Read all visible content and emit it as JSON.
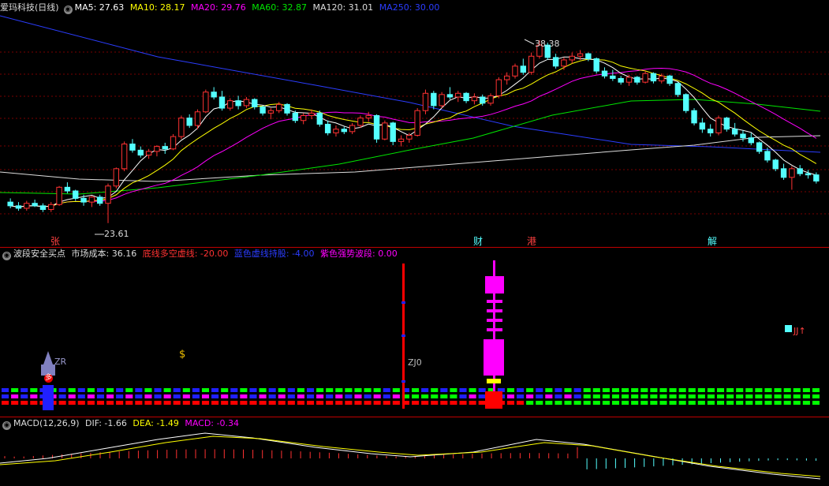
{
  "colors": {
    "up": "#ff3232",
    "down": "#54ffff",
    "ma5": "#ffffff",
    "ma10": "#ffff00",
    "ma20": "#ff00ff",
    "ma60": "#00e600",
    "ma120": "#dddddd",
    "ma250": "#2b3dff"
  },
  "main": {
    "stock_name": "爱玛科技(日线)",
    "ma5": "MA5: 27.63",
    "ma10": "MA10: 28.17",
    "ma20": "MA20: 29.76",
    "ma60": "MA60: 32.87",
    "ma120": "MA120: 31.01",
    "ma250": "MA250: 30.00",
    "high_label": "38.38",
    "low_label": "23.61",
    "markers": [
      "张",
      "财",
      "港",
      "解"
    ]
  },
  "indicator": {
    "name": "波段安全买点",
    "cost": "市场成本: 36.16",
    "bottom": "底线多空虚线: -20.00",
    "blue": "蓝色虚线持股: -4.00",
    "purple": "紫色强势波段: 0.00",
    "zr": "ZR",
    "zj": "ZJ0",
    "jj": "JJ↑",
    "duo": "多"
  },
  "macd": {
    "name": "MACD(12,26,9)",
    "dif": "DIF: -1.66",
    "dea": "DEA: -1.49",
    "macd": "MACD: -0.34"
  },
  "chart_data": {
    "type": "candlestick",
    "price_high": 38.38,
    "price_low": 23.61,
    "ylim": [
      22.5,
      40.5
    ],
    "candles": [
      [
        25.3,
        25.6,
        24.8,
        25.0
      ],
      [
        25.0,
        25.3,
        24.6,
        24.8
      ],
      [
        24.8,
        25.4,
        24.6,
        25.2
      ],
      [
        25.2,
        25.5,
        24.9,
        25.0
      ],
      [
        25.0,
        25.2,
        24.5,
        24.7
      ],
      [
        24.7,
        25.3,
        24.5,
        25.1
      ],
      [
        25.1,
        26.6,
        25.0,
        26.5
      ],
      [
        26.5,
        26.9,
        26.0,
        26.2
      ],
      [
        26.2,
        26.3,
        25.4,
        25.6
      ],
      [
        25.6,
        25.9,
        25.0,
        25.3
      ],
      [
        25.3,
        25.8,
        24.9,
        25.7
      ],
      [
        25.7,
        25.9,
        25.0,
        25.2
      ],
      [
        25.2,
        26.8,
        23.6,
        26.6
      ],
      [
        26.6,
        28.1,
        26.4,
        28.0
      ],
      [
        28.0,
        30.2,
        27.8,
        30.0
      ],
      [
        30.0,
        30.4,
        29.3,
        29.5
      ],
      [
        29.5,
        29.8,
        28.9,
        29.1
      ],
      [
        29.1,
        29.6,
        28.8,
        29.4
      ],
      [
        29.4,
        29.9,
        29.0,
        29.8
      ],
      [
        29.8,
        30.1,
        29.2,
        29.6
      ],
      [
        29.6,
        30.8,
        29.5,
        30.6
      ],
      [
        30.6,
        32.3,
        30.4,
        32.1
      ],
      [
        32.1,
        32.4,
        31.3,
        31.5
      ],
      [
        31.5,
        32.8,
        31.2,
        32.6
      ],
      [
        32.6,
        34.4,
        32.5,
        34.2
      ],
      [
        34.2,
        34.6,
        33.6,
        33.8
      ],
      [
        33.8,
        34.3,
        32.7,
        32.9
      ],
      [
        32.9,
        33.7,
        32.7,
        33.5
      ],
      [
        33.5,
        33.9,
        32.8,
        33.1
      ],
      [
        33.1,
        33.8,
        32.9,
        33.6
      ],
      [
        33.6,
        33.7,
        32.8,
        33.0
      ],
      [
        33.0,
        33.1,
        32.3,
        32.5
      ],
      [
        32.5,
        32.9,
        32.0,
        32.7
      ],
      [
        32.7,
        33.4,
        32.5,
        33.2
      ],
      [
        33.2,
        33.3,
        32.3,
        32.5
      ],
      [
        32.5,
        32.7,
        31.7,
        31.9
      ],
      [
        31.9,
        32.5,
        31.6,
        32.3
      ],
      [
        32.3,
        32.8,
        32.0,
        32.5
      ],
      [
        32.5,
        32.7,
        31.4,
        31.6
      ],
      [
        31.6,
        31.9,
        30.7,
        30.9
      ],
      [
        30.9,
        31.5,
        30.6,
        31.2
      ],
      [
        31.2,
        31.4,
        30.8,
        31.0
      ],
      [
        31.0,
        31.7,
        30.8,
        31.5
      ],
      [
        31.5,
        32.3,
        31.3,
        32.1
      ],
      [
        32.1,
        32.6,
        31.8,
        32.3
      ],
      [
        32.3,
        32.4,
        30.1,
        30.4
      ],
      [
        30.4,
        31.9,
        30.3,
        31.7
      ],
      [
        31.7,
        31.8,
        29.9,
        30.2
      ],
      [
        30.2,
        30.7,
        29.8,
        30.4
      ],
      [
        30.4,
        30.9,
        30.1,
        30.7
      ],
      [
        30.7,
        32.9,
        30.6,
        32.7
      ],
      [
        32.7,
        34.4,
        32.4,
        34.1
      ],
      [
        34.1,
        34.3,
        32.8,
        33.1
      ],
      [
        33.1,
        34.2,
        32.9,
        34.0
      ],
      [
        34.0,
        34.6,
        33.6,
        33.8
      ],
      [
        33.8,
        34.3,
        33.4,
        34.1
      ],
      [
        34.1,
        34.2,
        33.3,
        33.5
      ],
      [
        33.5,
        34.1,
        33.2,
        33.8
      ],
      [
        33.8,
        34.0,
        33.1,
        33.3
      ],
      [
        33.3,
        34.1,
        33.1,
        33.9
      ],
      [
        33.9,
        35.4,
        33.7,
        35.2
      ],
      [
        35.2,
        35.8,
        34.8,
        35.5
      ],
      [
        35.5,
        36.5,
        35.3,
        36.3
      ],
      [
        36.3,
        36.9,
        35.6,
        35.8
      ],
      [
        35.8,
        37.4,
        35.6,
        37.1
      ],
      [
        37.1,
        38.4,
        36.9,
        38.0
      ],
      [
        38.0,
        38.2,
        36.8,
        37.0
      ],
      [
        37.0,
        37.3,
        36.1,
        36.3
      ],
      [
        36.3,
        37.0,
        36.0,
        36.8
      ],
      [
        36.8,
        37.4,
        36.5,
        37.1
      ],
      [
        37.1,
        37.6,
        36.8,
        37.3
      ],
      [
        37.3,
        37.4,
        36.7,
        36.9
      ],
      [
        36.9,
        37.0,
        35.7,
        35.9
      ],
      [
        35.9,
        36.2,
        35.3,
        35.5
      ],
      [
        35.5,
        36.0,
        35.1,
        35.3
      ],
      [
        35.3,
        35.5,
        34.8,
        35.0
      ],
      [
        35.0,
        35.6,
        34.7,
        35.4
      ],
      [
        35.4,
        35.5,
        34.8,
        35.0
      ],
      [
        35.0,
        35.9,
        34.9,
        35.7
      ],
      [
        35.7,
        35.8,
        34.9,
        35.1
      ],
      [
        35.1,
        35.7,
        34.9,
        35.5
      ],
      [
        35.5,
        35.6,
        34.7,
        34.9
      ],
      [
        34.9,
        35.0,
        33.8,
        34.0
      ],
      [
        34.0,
        34.1,
        32.5,
        32.7
      ],
      [
        32.7,
        32.9,
        31.5,
        31.7
      ],
      [
        31.7,
        32.1,
        30.9,
        31.2
      ],
      [
        31.2,
        31.6,
        30.6,
        30.9
      ],
      [
        30.9,
        32.3,
        30.7,
        32.1
      ],
      [
        32.1,
        32.2,
        31.0,
        31.2
      ],
      [
        31.2,
        31.7,
        30.6,
        30.8
      ],
      [
        30.8,
        31.1,
        30.2,
        30.5
      ],
      [
        30.5,
        30.9,
        29.9,
        30.1
      ],
      [
        30.1,
        30.2,
        29.2,
        29.4
      ],
      [
        29.4,
        29.7,
        28.5,
        28.7
      ],
      [
        28.7,
        28.8,
        27.8,
        28.0
      ],
      [
        28.0,
        28.4,
        27.1,
        27.3
      ],
      [
        27.3,
        28.2,
        26.3,
        28.0
      ],
      [
        28.0,
        28.3,
        27.4,
        27.6
      ],
      [
        27.6,
        27.9,
        27.2,
        27.5
      ],
      [
        27.5,
        27.7,
        26.8,
        27.0
      ]
    ]
  }
}
